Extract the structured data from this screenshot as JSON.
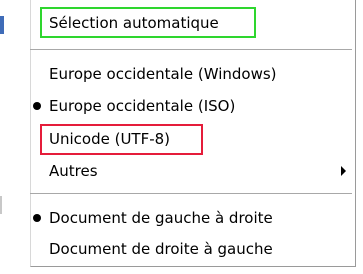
{
  "menu": {
    "items": [
      {
        "label": "Sélection automatique",
        "bullet": false,
        "submenu": false
      },
      {
        "label": "Europe occidentale (Windows)",
        "bullet": false,
        "submenu": false
      },
      {
        "label": "Europe occidentale (ISO)",
        "bullet": true,
        "submenu": false
      },
      {
        "label": "Unicode (UTF-8)",
        "bullet": false,
        "submenu": false
      },
      {
        "label": "Autres",
        "bullet": false,
        "submenu": true
      },
      {
        "label": "Document de gauche à droite",
        "bullet": true,
        "submenu": false
      },
      {
        "label": "Document de droite à gauche",
        "bullet": false,
        "submenu": false
      }
    ]
  },
  "highlights": {
    "green_color": "#2ed62e",
    "red_color": "#e51c3a"
  }
}
